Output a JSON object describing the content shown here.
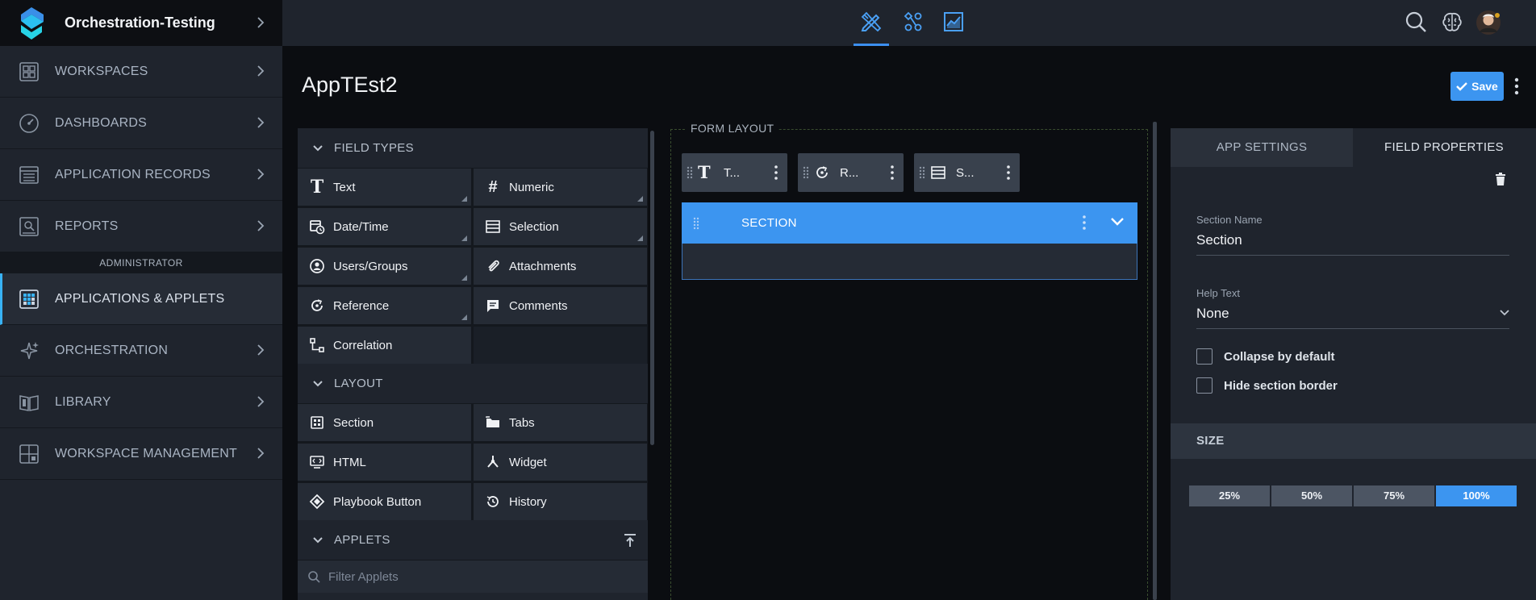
{
  "brand": {
    "name": "Orchestration-Testing"
  },
  "nav": [
    {
      "label": "WORKSPACES",
      "icon": "workspaces-icon"
    },
    {
      "label": "DASHBOARDS",
      "icon": "dashboard-gauge-icon"
    },
    {
      "label": "APPLICATION RECORDS",
      "icon": "records-icon"
    },
    {
      "label": "REPORTS",
      "icon": "reports-icon"
    }
  ],
  "admin_label": "ADMINISTRATOR",
  "admin_nav": [
    {
      "label": "APPLICATIONS & APPLETS",
      "icon": "applications-icon",
      "active": true
    },
    {
      "label": "ORCHESTRATION",
      "icon": "sparkle-icon"
    },
    {
      "label": "LIBRARY",
      "icon": "library-book-icon"
    },
    {
      "label": "WORKSPACE MANAGEMENT",
      "icon": "workspace-management-icon"
    }
  ],
  "topbar": {
    "tabs": [
      {
        "name": "design",
        "icon": "design-tools-icon",
        "active": true
      },
      {
        "name": "orchestration",
        "icon": "workflow-icon"
      },
      {
        "name": "reporting",
        "icon": "chart-icon"
      }
    ],
    "right_icons": [
      "search-icon",
      "brain-icon",
      "user-avatar"
    ]
  },
  "main": {
    "title": "AppTEst2",
    "save_label": "Save"
  },
  "field_panel": {
    "field_types_heading": "FIELD TYPES",
    "field_types": [
      {
        "label": "Text",
        "icon": "text-t-icon"
      },
      {
        "label": "Numeric",
        "icon": "hash-icon"
      },
      {
        "label": "Date/Time",
        "icon": "calendar-clock-icon"
      },
      {
        "label": "Selection",
        "icon": "list-lines-icon"
      },
      {
        "label": "Users/Groups",
        "icon": "user-circle-icon"
      },
      {
        "label": "Attachments",
        "icon": "paperclip-icon"
      },
      {
        "label": "Reference",
        "icon": "reference-icon"
      },
      {
        "label": "Comments",
        "icon": "comment-icon"
      },
      {
        "label": "Correlation",
        "icon": "correlation-icon"
      }
    ],
    "layout_heading": "LAYOUT",
    "layout_items": [
      {
        "label": "Section",
        "icon": "section-grid-icon"
      },
      {
        "label": "Tabs",
        "icon": "tabs-folder-icon"
      },
      {
        "label": "HTML",
        "icon": "html-icon"
      },
      {
        "label": "Widget",
        "icon": "widget-icon"
      },
      {
        "label": "Playbook Button",
        "icon": "playbook-diamond-icon"
      },
      {
        "label": "History",
        "icon": "history-icon"
      }
    ],
    "applets_heading": "APPLETS",
    "filter_placeholder": "Filter Applets"
  },
  "form_layout": {
    "legend": "FORM LAYOUT",
    "chips": [
      {
        "label": "T...",
        "icon": "text-t-icon"
      },
      {
        "label": "R...",
        "icon": "reference-icon"
      },
      {
        "label": "S...",
        "icon": "list-lines-icon"
      }
    ],
    "section_title": "SECTION"
  },
  "right_panel": {
    "tabs": [
      "APP SETTINGS",
      "FIELD PROPERTIES"
    ],
    "active_tab": "FIELD PROPERTIES",
    "section_name_label": "Section Name",
    "section_name_value": "Section",
    "help_text_label": "Help Text",
    "help_text_value": "None",
    "collapse_label": "Collapse by default",
    "hide_border_label": "Hide section border",
    "size_heading": "SIZE",
    "size_options": [
      "25%",
      "50%",
      "75%",
      "100%"
    ],
    "size_selected": "100%"
  },
  "colors": {
    "accent": "#3c95f0",
    "sidebar_bg": "#1f242d",
    "page_bg": "#0b0d11",
    "active_indicator": "#38b2f4"
  }
}
